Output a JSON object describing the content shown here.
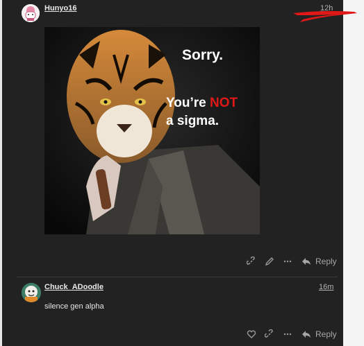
{
  "posts": [
    {
      "username": "Hunyo16",
      "time": "12h",
      "image_text": {
        "line1": "Sorry.",
        "line2_a": "You’re ",
        "line2_b": "NOT",
        "line3": "a sigma."
      },
      "actions": {
        "icons": [
          "link-icon",
          "pencil-icon",
          "more-icon"
        ],
        "reply_label": "Reply"
      }
    },
    {
      "username": "Chuck_ADoodle",
      "time": "16m",
      "text": "silence gen alpha",
      "actions": {
        "icons": [
          "heart-icon",
          "link-icon",
          "more-icon"
        ],
        "reply_label": "Reply"
      }
    }
  ],
  "colors": {
    "background": "#222222",
    "annotation_red": "#e01818",
    "meme_red": "#e01818"
  }
}
